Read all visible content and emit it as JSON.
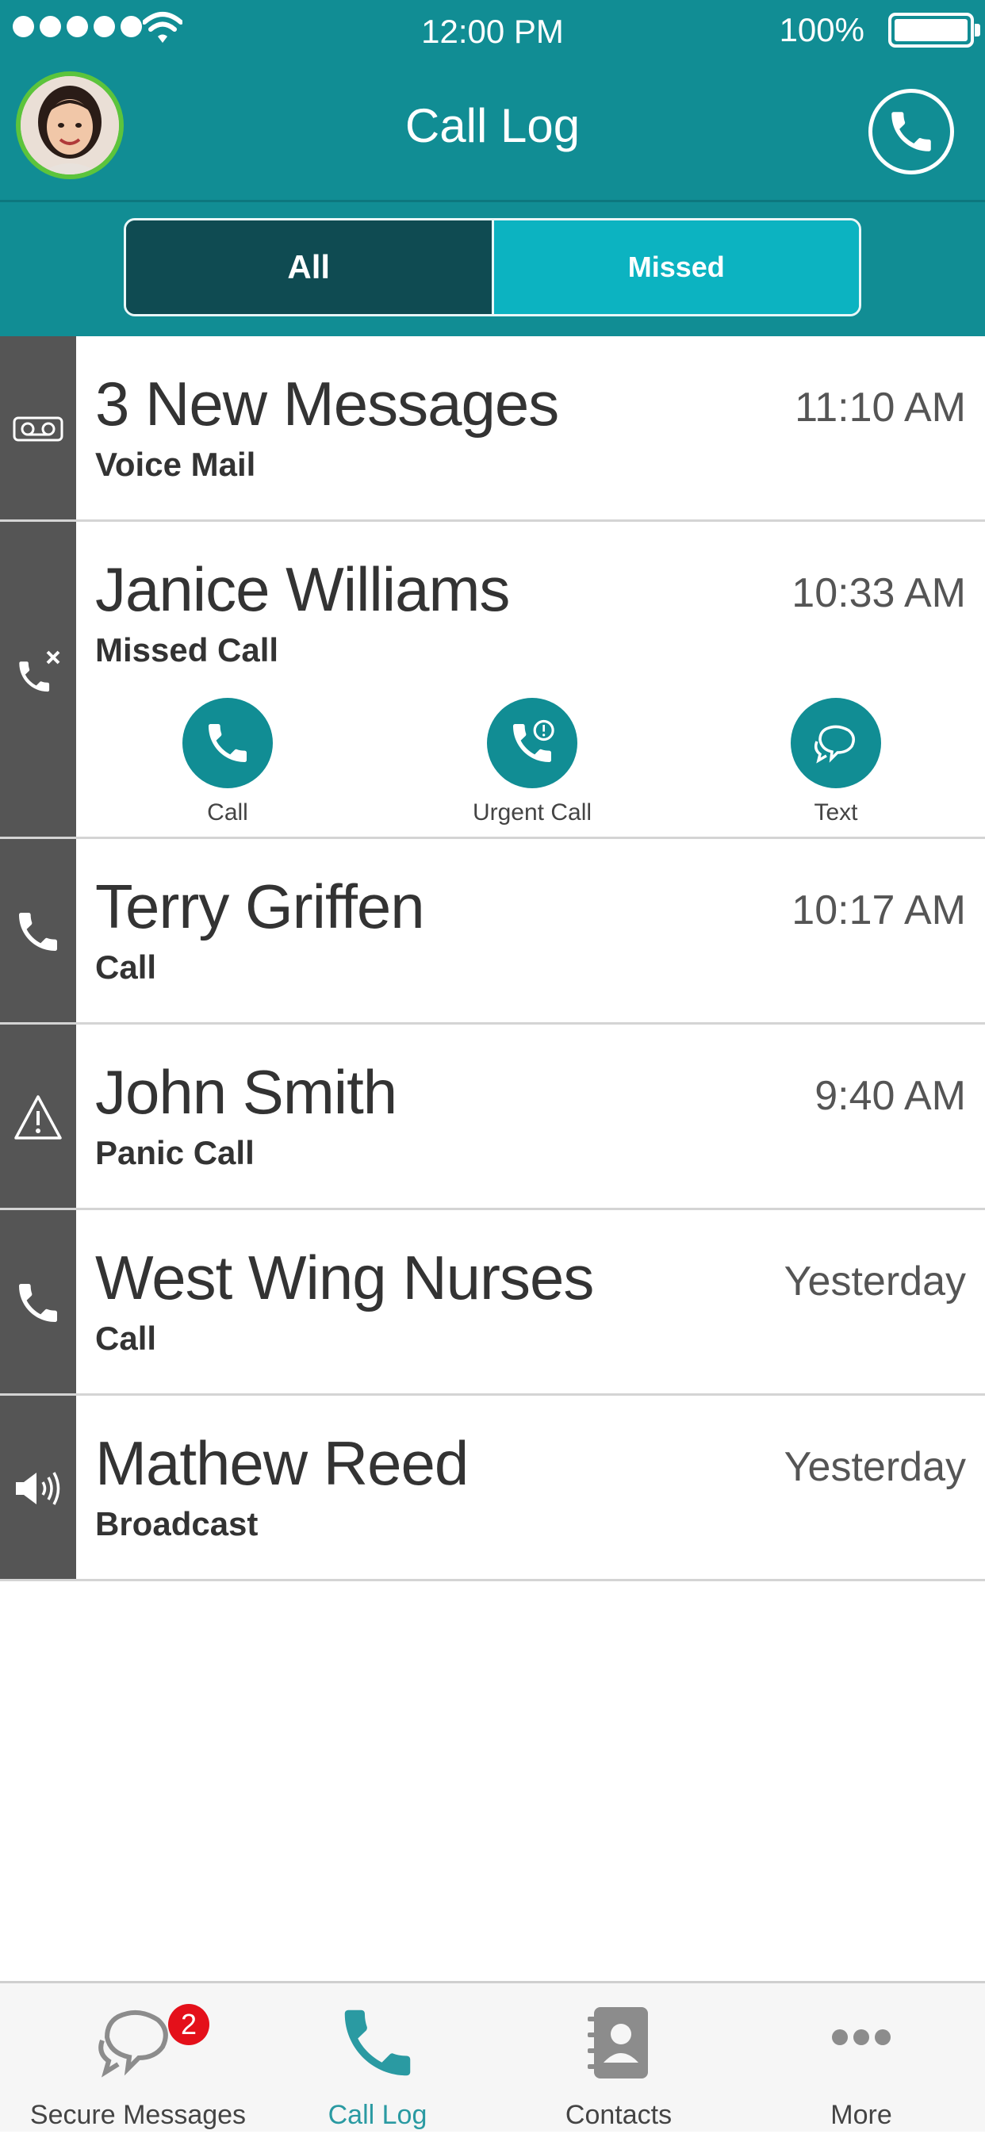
{
  "status_bar": {
    "time": "12:00 PM",
    "battery": "100%"
  },
  "header": {
    "title": "Call Log",
    "avatar_icon": "user-avatar",
    "call_icon": "phone-icon"
  },
  "segments": {
    "all": "All",
    "missed": "Missed"
  },
  "colors": {
    "header": "#118d94",
    "active_segment": "#0f4b52",
    "inactive_segment": "#0cb3c1",
    "rail": "#555555",
    "badge": "#e4101a",
    "active_tab": "#2a9aa2"
  },
  "entries": [
    {
      "name": "3 New Messages",
      "type": "Voice Mail",
      "time": "11:10 AM",
      "icon": "voicemail-icon"
    },
    {
      "name": "Janice Williams",
      "type": "Missed Call",
      "time": "10:33 AM",
      "icon": "missed-call-icon",
      "actions": [
        {
          "label": "Call",
          "icon": "phone-icon"
        },
        {
          "label": "Urgent Call",
          "icon": "urgent-call-icon"
        },
        {
          "label": "Text",
          "icon": "chat-icon"
        }
      ]
    },
    {
      "name": "Terry Griffen",
      "type": "Call",
      "time": "10:17 AM",
      "icon": "phone-icon"
    },
    {
      "name": "John Smith",
      "type": "Panic Call",
      "time": "9:40 AM",
      "icon": "warning-icon"
    },
    {
      "name": "West Wing Nurses",
      "type": "Call",
      "time": "Yesterday",
      "icon": "phone-icon"
    },
    {
      "name": "Mathew Reed",
      "type": "Broadcast",
      "time": "Yesterday",
      "icon": "speaker-icon"
    }
  ],
  "tabbar": [
    {
      "label": "Secure Messages",
      "icon": "chat-bubbles-icon",
      "badge": "2"
    },
    {
      "label": "Call Log",
      "icon": "phone-icon",
      "active": true
    },
    {
      "label": "Contacts",
      "icon": "contacts-book-icon"
    },
    {
      "label": "More",
      "icon": "more-dots-icon"
    }
  ]
}
